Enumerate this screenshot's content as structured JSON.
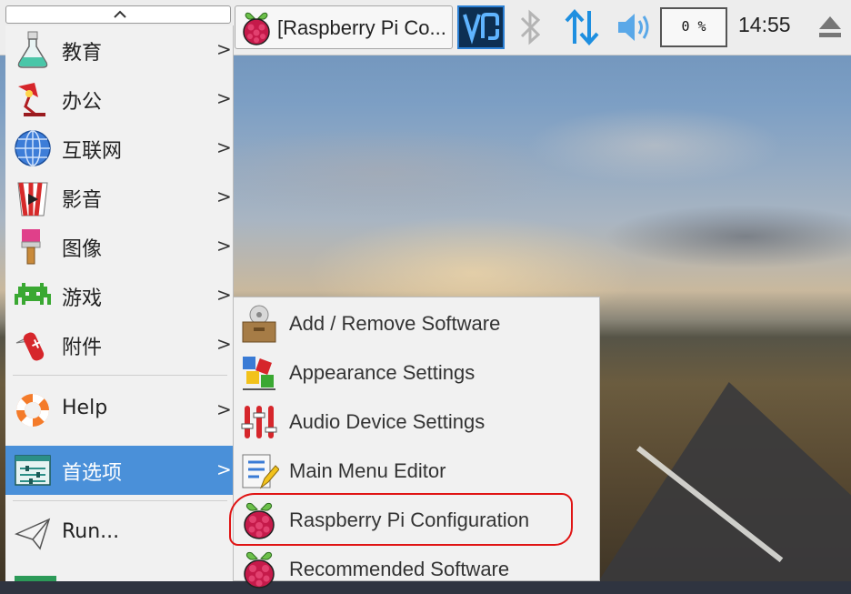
{
  "panel": {
    "window_title": "[Raspberry Pi Co...",
    "cpu_usage": "0 %",
    "clock": "14:55"
  },
  "icons": {
    "menu_up": "chevron-up-icon",
    "window": "raspberry-pi-icon",
    "vnc": "vnc-icon",
    "bluetooth": "bluetooth-icon",
    "network": "network-arrows-icon",
    "volume": "volume-icon",
    "eject": "eject-icon"
  },
  "main_menu": {
    "items": [
      {
        "label": "教育",
        "icon": "flask-icon"
      },
      {
        "label": "办公",
        "icon": "desk-lamp-icon"
      },
      {
        "label": "互联网",
        "icon": "globe-icon"
      },
      {
        "label": "影音",
        "icon": "film-popcorn-icon"
      },
      {
        "label": "图像",
        "icon": "paintbrush-icon"
      },
      {
        "label": "游戏",
        "icon": "space-invader-icon"
      },
      {
        "label": "附件",
        "icon": "pocket-knife-icon"
      },
      {
        "label": "Help",
        "icon": "lifebuoy-icon"
      },
      {
        "label": "首选项",
        "icon": "settings-panel-icon",
        "selected": true
      },
      {
        "label": "Run...",
        "icon": "paper-plane-icon"
      }
    ],
    "arrow": ">"
  },
  "sub_menu": {
    "items": [
      {
        "label": "Add / Remove Software",
        "icon": "package-icon"
      },
      {
        "label": "Appearance Settings",
        "icon": "color-swatch-icon"
      },
      {
        "label": "Audio Device Settings",
        "icon": "mixer-sliders-icon"
      },
      {
        "label": "Main Menu Editor",
        "icon": "menu-editor-icon"
      },
      {
        "label": "Raspberry Pi Configuration",
        "icon": "raspberry-pi-icon",
        "annotated": true
      },
      {
        "label": "Recommended Software",
        "icon": "raspberry-pi-icon"
      }
    ]
  },
  "colors": {
    "selection": "#4a90d9",
    "annotation": "#e01414",
    "raspberry": "#c51a4a"
  }
}
